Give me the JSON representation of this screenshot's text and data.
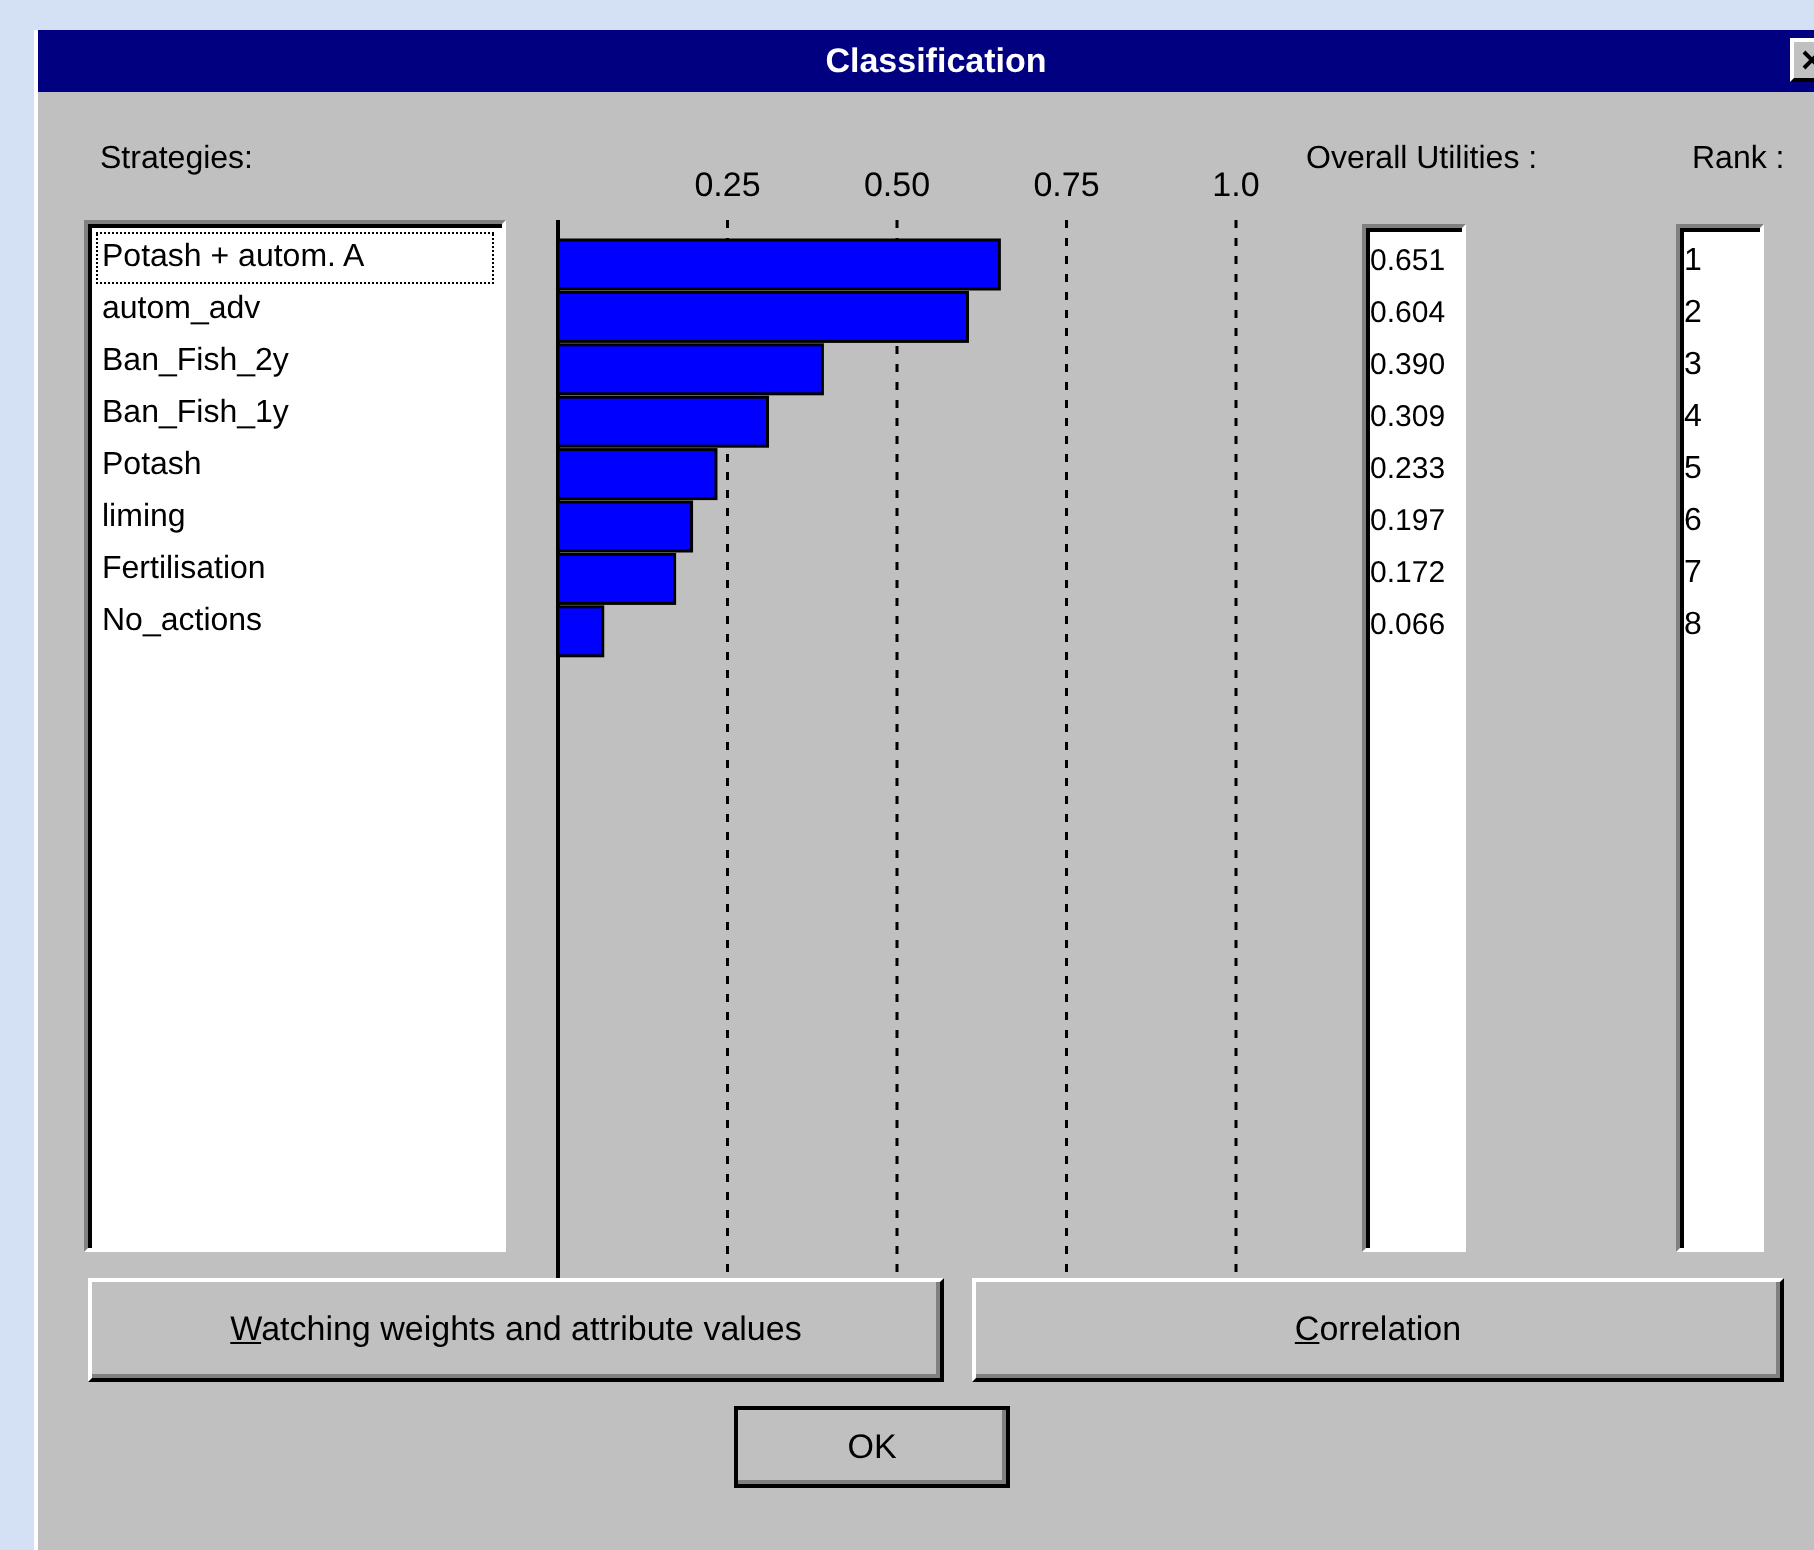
{
  "window": {
    "title": "Classification"
  },
  "strategies": {
    "label": "Strategies:",
    "items": [
      {
        "text": "Potash + autom. A",
        "focused": true
      },
      {
        "text": "autom_adv",
        "focused": false
      },
      {
        "text": "Ban_Fish_2y",
        "focused": false
      },
      {
        "text": "Ban_Fish_1y",
        "focused": false
      },
      {
        "text": "Potash",
        "focused": false
      },
      {
        "text": "liming",
        "focused": false
      },
      {
        "text": "Fertilisation",
        "focused": false
      },
      {
        "text": "No_actions",
        "focused": false
      }
    ]
  },
  "chart_data": {
    "type": "bar",
    "orientation": "horizontal",
    "grid": true,
    "xlim": [
      0,
      1.0
    ],
    "xticks": [
      {
        "value": 0.25,
        "label": "0.25"
      },
      {
        "value": 0.5,
        "label": "0.50"
      },
      {
        "value": 0.75,
        "label": "0.75"
      },
      {
        "value": 1.0,
        "label": "1.0"
      }
    ],
    "series": [
      {
        "color": "#0000ff",
        "values": [
          0.651,
          0.604,
          0.39,
          0.309,
          0.233,
          0.197,
          0.172,
          0.066
        ]
      }
    ]
  },
  "utilities": {
    "label": "Overall Utilities :",
    "items": [
      "0.651",
      "0.604",
      "0.390",
      "0.309",
      "0.233",
      "0.197",
      "0.172",
      "0.066"
    ]
  },
  "rank": {
    "label": "Rank :",
    "items": [
      "1",
      "2",
      "3",
      "4",
      "5",
      "6",
      "7",
      "8"
    ]
  },
  "buttons": [
    {
      "label": "Watching weights and attribute values",
      "underline_first": true,
      "default": false
    },
    {
      "label": "Correlation",
      "underline_first": true,
      "default": false
    }
  ],
  "ok_button": {
    "label": "OK",
    "underline_first": false,
    "default": true
  }
}
